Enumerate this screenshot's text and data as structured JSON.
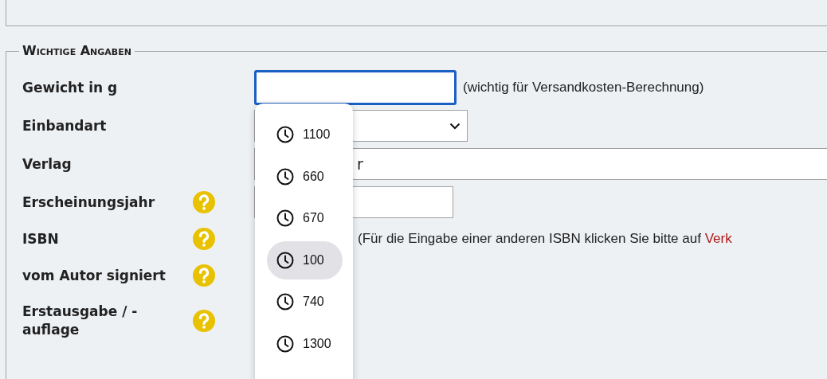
{
  "section": {
    "legend": "Wichtige Angaben"
  },
  "fields": [
    {
      "kind": "text",
      "label": "Gewicht in g",
      "help": false,
      "focused": true,
      "note": "(wichtig für Versandkosten-Berechnung)"
    },
    {
      "kind": "select",
      "label": "Einbandart",
      "help": false
    },
    {
      "kind": "wide",
      "label": "Verlag",
      "help": false,
      "value": "r"
    },
    {
      "kind": "short",
      "label": "Erscheinungsjahr",
      "help": true
    },
    {
      "kind": "info",
      "label": "ISBN",
      "help": true,
      "note": "(Für die Eingabe einer anderen ISBN klicken Sie bitte auf ",
      "link": "Verk"
    },
    {
      "kind": "none",
      "label": "vom Autor signiert",
      "help": true
    },
    {
      "kind": "none",
      "label": "Erstausgabe / -auflage",
      "help": true
    }
  ],
  "suggestions": [
    {
      "value": "1100",
      "selected": false
    },
    {
      "value": "660",
      "selected": false
    },
    {
      "value": "670",
      "selected": false
    },
    {
      "value": "100",
      "selected": true
    },
    {
      "value": "740",
      "selected": false
    },
    {
      "value": "1300",
      "selected": false
    }
  ]
}
